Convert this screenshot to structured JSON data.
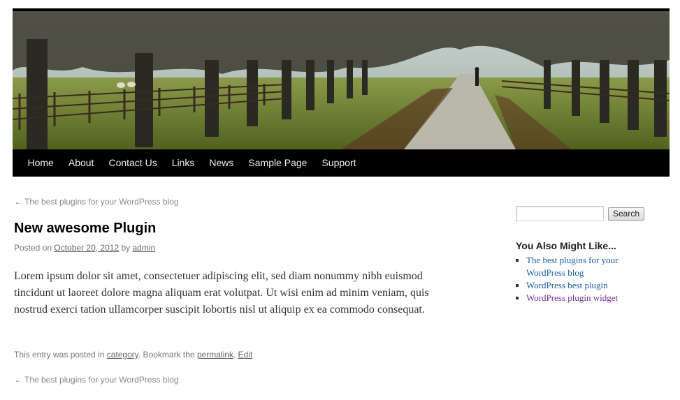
{
  "header": {
    "image_alt": "Tree-lined country road with fences and sheep"
  },
  "nav": {
    "items": [
      "Home",
      "About",
      "Contact Us",
      "Links",
      "News",
      "Sample Page",
      "Support"
    ]
  },
  "post": {
    "prev_link_top": "The best plugins for your WordPress blog",
    "title": "New awesome Plugin",
    "meta": {
      "posted_on": "Posted on",
      "date": "October 20, 2012",
      "by": "by",
      "author": "admin"
    },
    "content": "Lorem ipsum dolor sit amet, consectetuer adipiscing elit, sed diam nonummy nibh euismod tincidunt ut laoreet dolore magna aliquam erat volutpat. Ut wisi enim ad minim veniam, quis nostrud exerci tation ullamcorper suscipit lobortis nisl ut aliquip ex ea commodo consequat.",
    "utility": {
      "posted_in": "This entry was posted in",
      "category": "category",
      "bookmark": ". Bookmark the",
      "permalink": "permalink",
      "period": ".",
      "edit": "Edit"
    },
    "prev_link_bottom": "The best plugins for your WordPress blog",
    "arrow": "←"
  },
  "sidebar": {
    "search_value": "",
    "search_button": "Search",
    "widget_title": "You Also Might Like...",
    "links": [
      "The best plugins for your WordPress blog",
      "WordPress best plugin",
      "WordPress plugin widget"
    ]
  },
  "colors": {
    "nav_bg": "#000000",
    "link": "#1b5fa8",
    "visited_link": "#743399"
  }
}
